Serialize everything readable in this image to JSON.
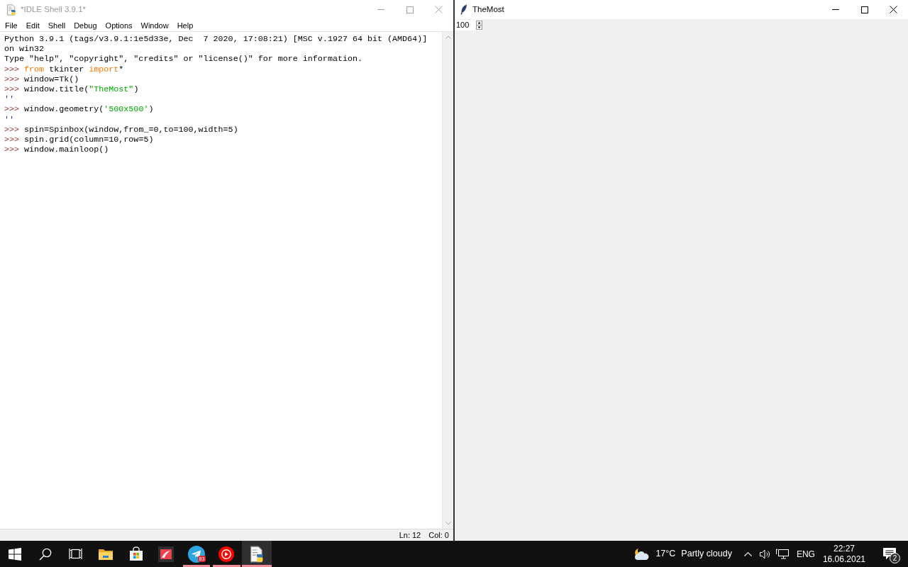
{
  "idle_window": {
    "title": "*IDLE Shell 3.9.1*",
    "active": false,
    "menu": [
      "File",
      "Edit",
      "Shell",
      "Debug",
      "Options",
      "Window",
      "Help"
    ],
    "lines": [
      [
        {
          "text": "Python 3.9.1 (tags/v3.9.1:1e5d33e, Dec  7 2020, 17:08:21) [MSC v.1927 64 bit (AMD64)]",
          "kind": "plain"
        }
      ],
      [
        {
          "text": "on win32",
          "kind": "plain"
        }
      ],
      [
        {
          "text": "Type \"help\", \"copyright\", \"credits\" or \"license()\" for more information.",
          "kind": "plain"
        }
      ],
      [
        {
          "text": ">>> ",
          "kind": "prompt"
        },
        {
          "text": "from",
          "kind": "keyword"
        },
        {
          "text": " tkinter ",
          "kind": "plain"
        },
        {
          "text": "import",
          "kind": "keyword"
        },
        {
          "text": "*",
          "kind": "plain"
        }
      ],
      [
        {
          "text": ">>> ",
          "kind": "prompt"
        },
        {
          "text": "window=Tk()",
          "kind": "plain"
        }
      ],
      [
        {
          "text": ">>> ",
          "kind": "prompt"
        },
        {
          "text": "window.title(",
          "kind": "plain"
        },
        {
          "text": "\"TheMost\"",
          "kind": "string"
        },
        {
          "text": ")",
          "kind": "plain"
        }
      ],
      [
        {
          "text": "''",
          "kind": "output"
        }
      ],
      [
        {
          "text": ">>> ",
          "kind": "prompt"
        },
        {
          "text": "window.geometry(",
          "kind": "plain"
        },
        {
          "text": "'500x500'",
          "kind": "string"
        },
        {
          "text": ")",
          "kind": "plain"
        }
      ],
      [
        {
          "text": "''",
          "kind": "output"
        }
      ],
      [
        {
          "text": ">>> ",
          "kind": "prompt"
        },
        {
          "text": "spin=Spinbox(window,from_=0,to=100,width=5)",
          "kind": "plain"
        }
      ],
      [
        {
          "text": ">>> ",
          "kind": "prompt"
        },
        {
          "text": "spin.grid(column=10,row=5)",
          "kind": "plain"
        }
      ],
      [
        {
          "text": ">>> ",
          "kind": "prompt"
        },
        {
          "text": "window.mainloop()",
          "kind": "plain"
        }
      ]
    ],
    "status_bar": {
      "line": "Ln: 12",
      "column": "Col: 0"
    }
  },
  "tk_window": {
    "title": "TheMost",
    "active": true,
    "spinbox": {
      "value": "100"
    }
  },
  "taskbar": {
    "apps": [
      {
        "running": false,
        "active": false
      },
      {
        "running": false,
        "active": false
      },
      {
        "running": false,
        "active": false
      },
      {
        "running": true,
        "active": false,
        "badge": "83"
      },
      {
        "running": true,
        "active": false
      },
      {
        "running": true,
        "active": true
      }
    ],
    "weather": {
      "temperature": "17°C",
      "condition": "Partly cloudy"
    },
    "language": "ENG",
    "clock": {
      "time": "22:27",
      "date": "16.06.2021"
    },
    "notifications": {
      "badge": "2"
    }
  }
}
